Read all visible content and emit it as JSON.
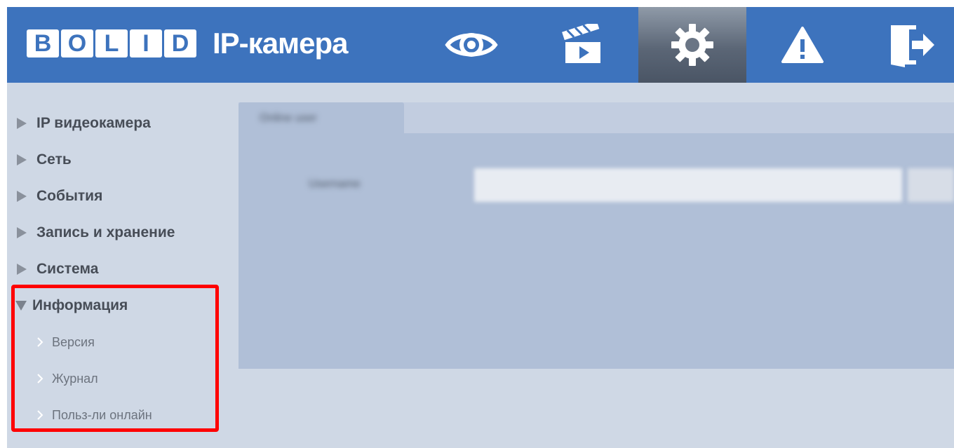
{
  "header": {
    "logo_letters": [
      "B",
      "O",
      "L",
      "I",
      "D"
    ],
    "app_title": "IP-камера",
    "nav": [
      {
        "icon": "eye-icon",
        "name": "live-view"
      },
      {
        "icon": "clapperboard-icon",
        "name": "playback"
      },
      {
        "icon": "gear-icon",
        "name": "settings",
        "active": true
      },
      {
        "icon": "warning-icon",
        "name": "alarm"
      },
      {
        "icon": "exit-icon",
        "name": "logout"
      }
    ],
    "colors": {
      "header_bg": "#3d73bd",
      "active_tab": "#5b6676"
    }
  },
  "sidebar": {
    "items": [
      {
        "label": "IP видеокамера",
        "expanded": false
      },
      {
        "label": "Сеть",
        "expanded": false
      },
      {
        "label": "События",
        "expanded": false
      },
      {
        "label": "Запись и хранение",
        "expanded": false
      },
      {
        "label": "Система",
        "expanded": false
      },
      {
        "label": "Информация",
        "expanded": true
      }
    ],
    "subitems": [
      {
        "label": "Версия"
      },
      {
        "label": "Журнал"
      },
      {
        "label": "Польз-ли онлайн"
      }
    ],
    "highlight_color": "#ff0000"
  },
  "main": {
    "tab_label": "Online user",
    "field_label": "Username"
  }
}
